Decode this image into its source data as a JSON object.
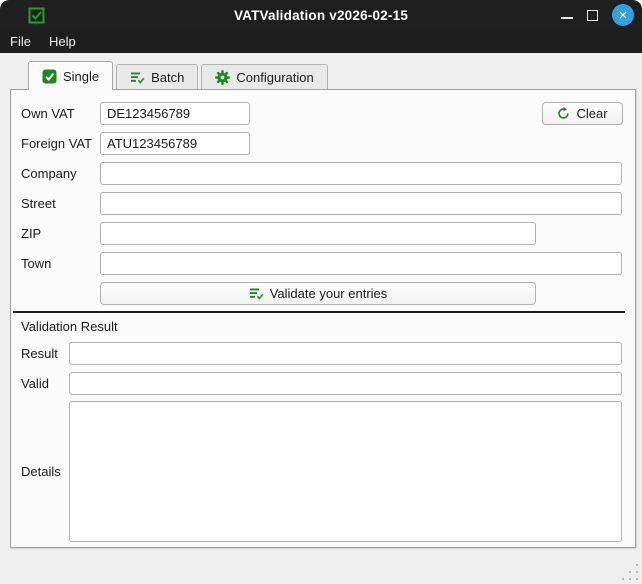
{
  "window": {
    "title": "VATValidation v2026-02-15",
    "controls": {
      "minimize": "minimize",
      "maximize": "maximize",
      "close": "×"
    }
  },
  "menu": {
    "items": [
      {
        "label": "File"
      },
      {
        "label": "Help"
      }
    ]
  },
  "tabs": [
    {
      "label": "Single",
      "icon": "check-square-icon",
      "active": true
    },
    {
      "label": "Batch",
      "icon": "list-check-icon",
      "active": false
    },
    {
      "label": "Configuration",
      "icon": "gear-icon",
      "active": false
    }
  ],
  "form": {
    "own_vat": {
      "label": "Own VAT",
      "value": "DE123456789"
    },
    "foreign_vat": {
      "label": "Foreign VAT",
      "value": "ATU123456789"
    },
    "company": {
      "label": "Company",
      "value": ""
    },
    "street": {
      "label": "Street",
      "value": ""
    },
    "zip": {
      "label": "ZIP",
      "value": ""
    },
    "town": {
      "label": "Town",
      "value": ""
    },
    "clear_button_label": "Clear",
    "validate_button_label": "Validate your entries"
  },
  "result_section": {
    "heading": "Validation Result",
    "result": {
      "label": "Result",
      "value": ""
    },
    "valid": {
      "label": "Valid",
      "value": ""
    },
    "details": {
      "label": "Details",
      "value": ""
    }
  },
  "colors": {
    "accent_green": "#1e871e",
    "titlebar_dark": "#1f1f1f",
    "close_button_blue": "#35a0e0",
    "panel_background": "#fbfbfb"
  }
}
